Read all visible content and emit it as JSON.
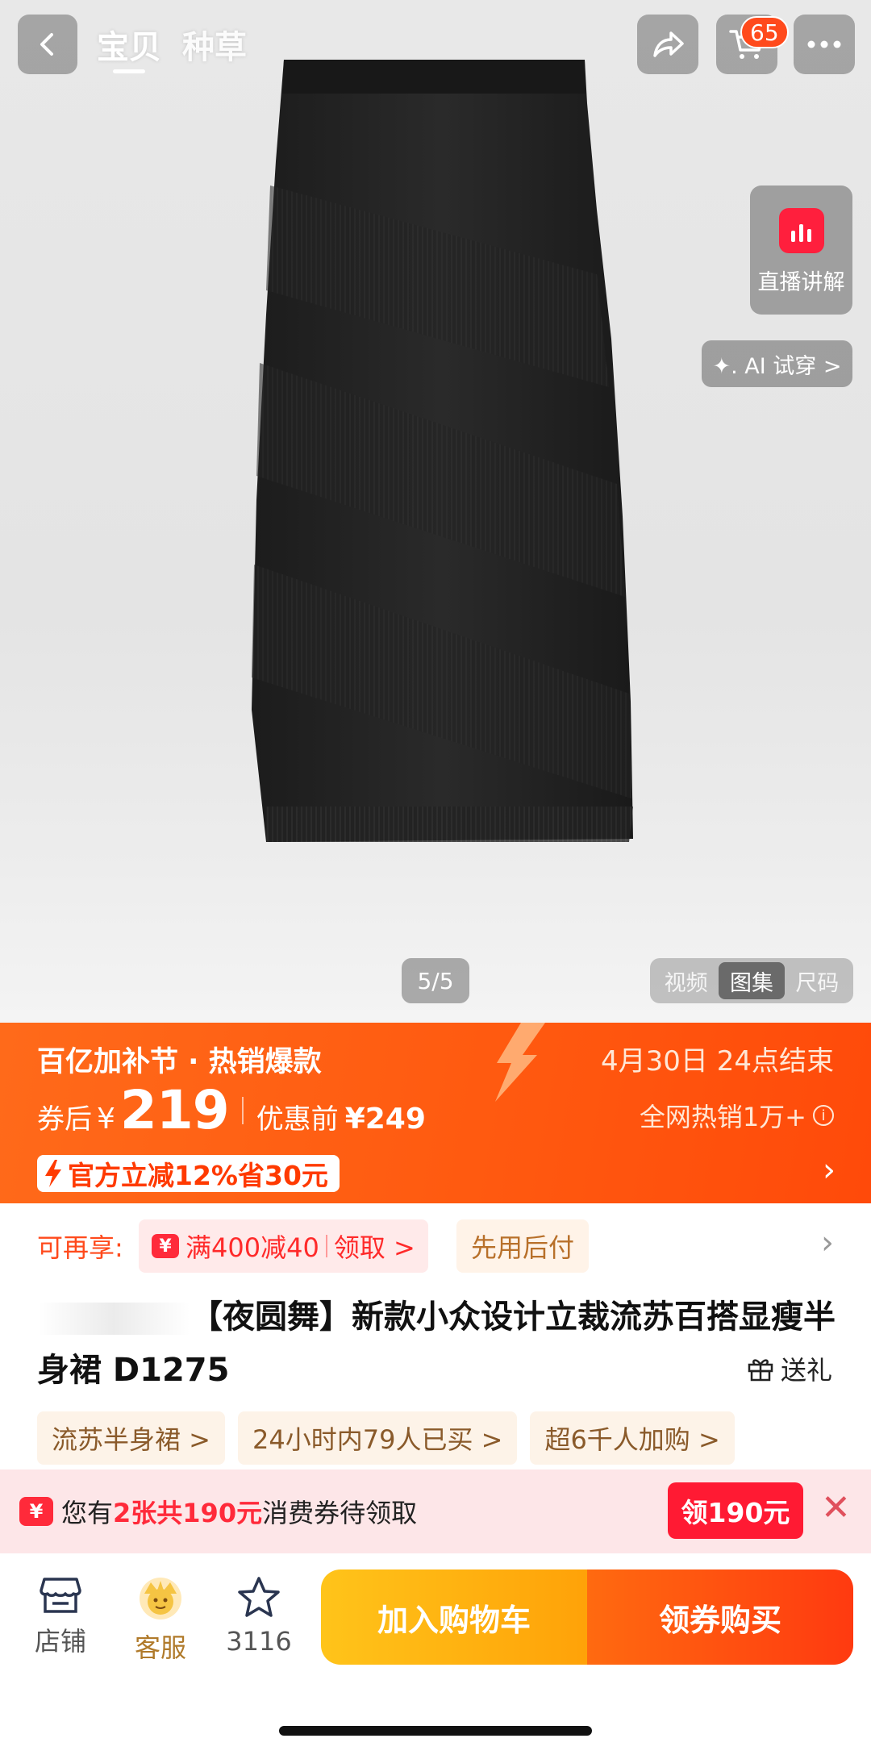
{
  "nav": {
    "tabs": [
      "宝贝",
      "种草"
    ],
    "cart_count": "65"
  },
  "hero": {
    "live_label": "直播讲解",
    "ai_label": "✦. AI 试穿 >",
    "image_counter": "5/5",
    "media_tabs": [
      "视频",
      "图集",
      "尺码"
    ]
  },
  "promo": {
    "title": "百亿加补节 · 热销爆款",
    "end_time": "4月30日 24点结束",
    "price_prefix": "券后",
    "currency": "¥",
    "price": "219",
    "orig_label": "优惠前",
    "orig_price": "¥249",
    "hot_text": "全网热销1万+",
    "discount_tag": "官方立减12%省30元"
  },
  "benefits": {
    "label": "可再享:",
    "coupon_text": "满400减40",
    "coupon_action": "领取 >",
    "paylater": "先用后付"
  },
  "product": {
    "title": "【夜圆舞】新款小众设计立裁流苏百搭显瘦半身裙 D1275",
    "gift": "送礼",
    "tags": [
      "流苏半身裙 >",
      "24小时内79人已买 >",
      "超6千人加购 >"
    ]
  },
  "notice": {
    "prefix": "您有",
    "highlight": "2张共190元",
    "suffix": "消费券待领取",
    "button": "领190元",
    "badge": "¥"
  },
  "bottom": {
    "shop_label": "店铺",
    "service_label": "客服",
    "fav_count": "3116",
    "add_cart": "加入购物车",
    "buy": "领券购买"
  },
  "colors": {
    "accent_orange": "#ff5a10",
    "red": "#ff1a33",
    "yellow": "#ffb010"
  }
}
